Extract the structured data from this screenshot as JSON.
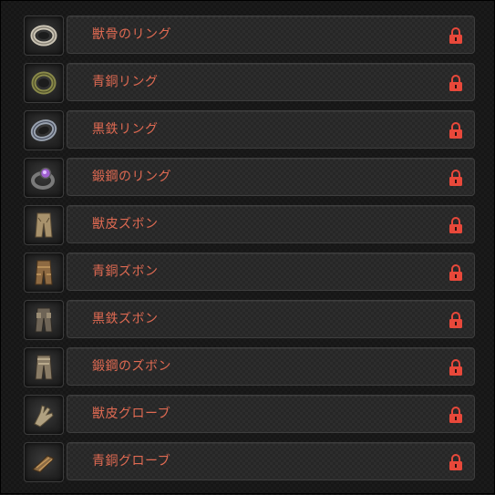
{
  "colors": {
    "label_text": "#e06a52",
    "lock": "#e8483a",
    "row_background": "#262626",
    "page_background": "#161616"
  },
  "items": [
    {
      "label": "獣骨のリング",
      "icon": "bone-ring-icon",
      "locked": true
    },
    {
      "label": "青銅リング",
      "icon": "bronze-ring-icon",
      "locked": true
    },
    {
      "label": "黒鉄リング",
      "icon": "black-iron-ring-icon",
      "locked": true
    },
    {
      "label": "鍛鋼のリング",
      "icon": "forged-steel-ring-icon",
      "locked": true
    },
    {
      "label": "獣皮ズボン",
      "icon": "beast-hide-pants-icon",
      "locked": true
    },
    {
      "label": "青銅ズボン",
      "icon": "bronze-pants-icon",
      "locked": true
    },
    {
      "label": "黒鉄ズボン",
      "icon": "black-iron-pants-icon",
      "locked": true
    },
    {
      "label": "鍛鋼のズボン",
      "icon": "forged-steel-pants-icon",
      "locked": true
    },
    {
      "label": "獣皮グローブ",
      "icon": "beast-hide-gloves-icon",
      "locked": true
    },
    {
      "label": "青銅グローブ",
      "icon": "bronze-gloves-icon",
      "locked": true
    }
  ]
}
